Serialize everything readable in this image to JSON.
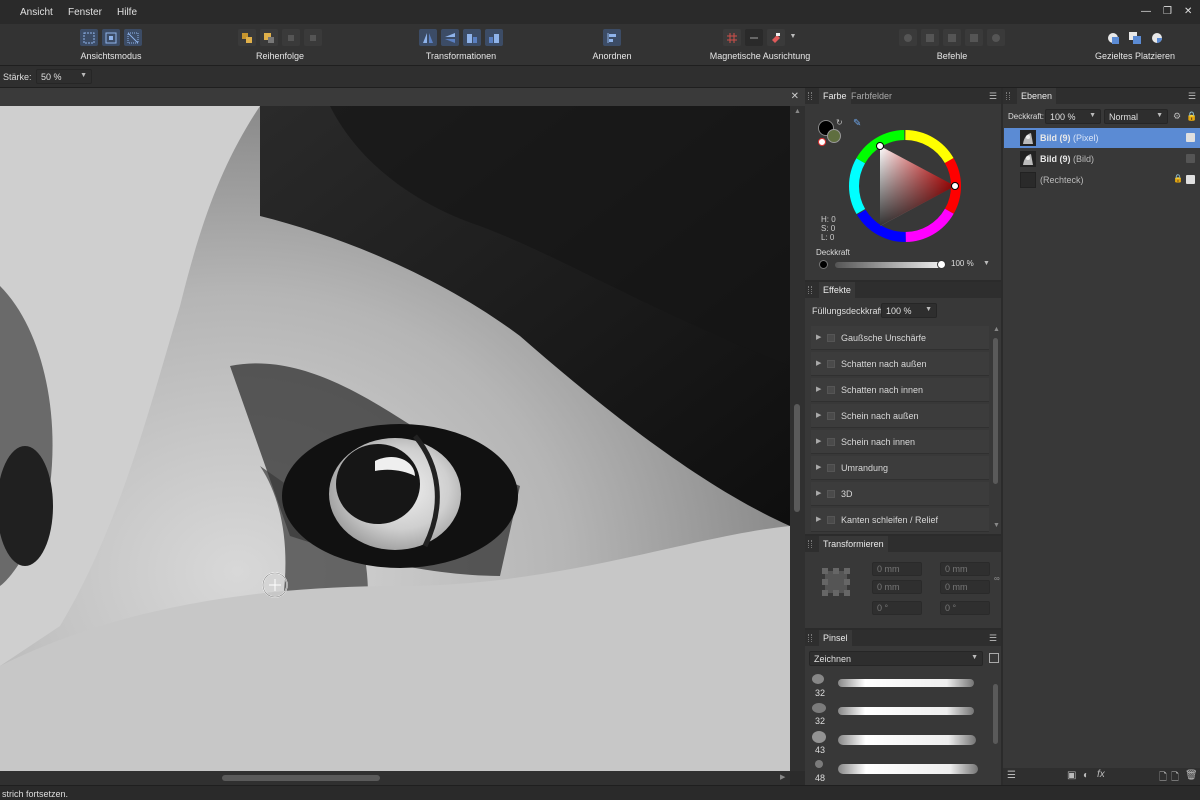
{
  "menu": {
    "items": [
      "Ansicht",
      "Fenster",
      "Hilfe"
    ]
  },
  "toolbar": {
    "groups": [
      {
        "label": "Ansichtsmodus"
      },
      {
        "label": "Reihenfolge"
      },
      {
        "label": "Transformationen"
      },
      {
        "label": "Anordnen"
      },
      {
        "label": "Magnetische Ausrichtung"
      },
      {
        "label": "Befehle"
      },
      {
        "label": "Gezieltes Platzieren"
      }
    ]
  },
  "context": {
    "strength_label": "Stärke:",
    "strength_value": "50 %"
  },
  "color_panel": {
    "tabs": [
      "Farbe",
      "Farbfelder"
    ],
    "hsl": {
      "h": "H: 0",
      "s": "S: 0",
      "l": "L: 0"
    },
    "opacity_label": "Deckkraft",
    "opacity_value": "100 %",
    "opacity_fraction": 1.0
  },
  "effects_panel": {
    "title": "Effekte",
    "fill_opacity_label": "Füllungsdeckkraft:",
    "fill_opacity_value": "100 %",
    "items": [
      "Gaußsche Unschärfe",
      "Schatten nach außen",
      "Schatten nach innen",
      "Schein nach außen",
      "Schein nach innen",
      "Umrandung",
      "3D",
      "Kanten schleifen / Relief"
    ]
  },
  "transform_panel": {
    "title": "Transformieren",
    "fields": [
      "0 mm",
      "0 mm",
      "0 mm",
      "0 mm",
      "0 °",
      "0 °"
    ]
  },
  "brush_panel": {
    "title": "Pinsel",
    "category": "Zeichnen",
    "sizes": [
      "32",
      "32",
      "43",
      "48"
    ]
  },
  "layers_panel": {
    "title": "Ebenen",
    "opacity_label": "Deckkraft:",
    "opacity_value": "100 %",
    "blend_mode": "Normal",
    "layers": [
      {
        "name": "Bild (9)",
        "type": "(Pixel)",
        "selected": true,
        "visible": true
      },
      {
        "name": "Bild (9)",
        "type": "(Bild)",
        "selected": false,
        "visible": false
      },
      {
        "name": "",
        "type": "(Rechteck)",
        "selected": false,
        "visible": true
      }
    ]
  },
  "status": {
    "text": "strich fortsetzen."
  },
  "colors": {
    "accent": "#5b8bd4",
    "panel": "#383838",
    "selected_layer": "#5b8bd4"
  }
}
